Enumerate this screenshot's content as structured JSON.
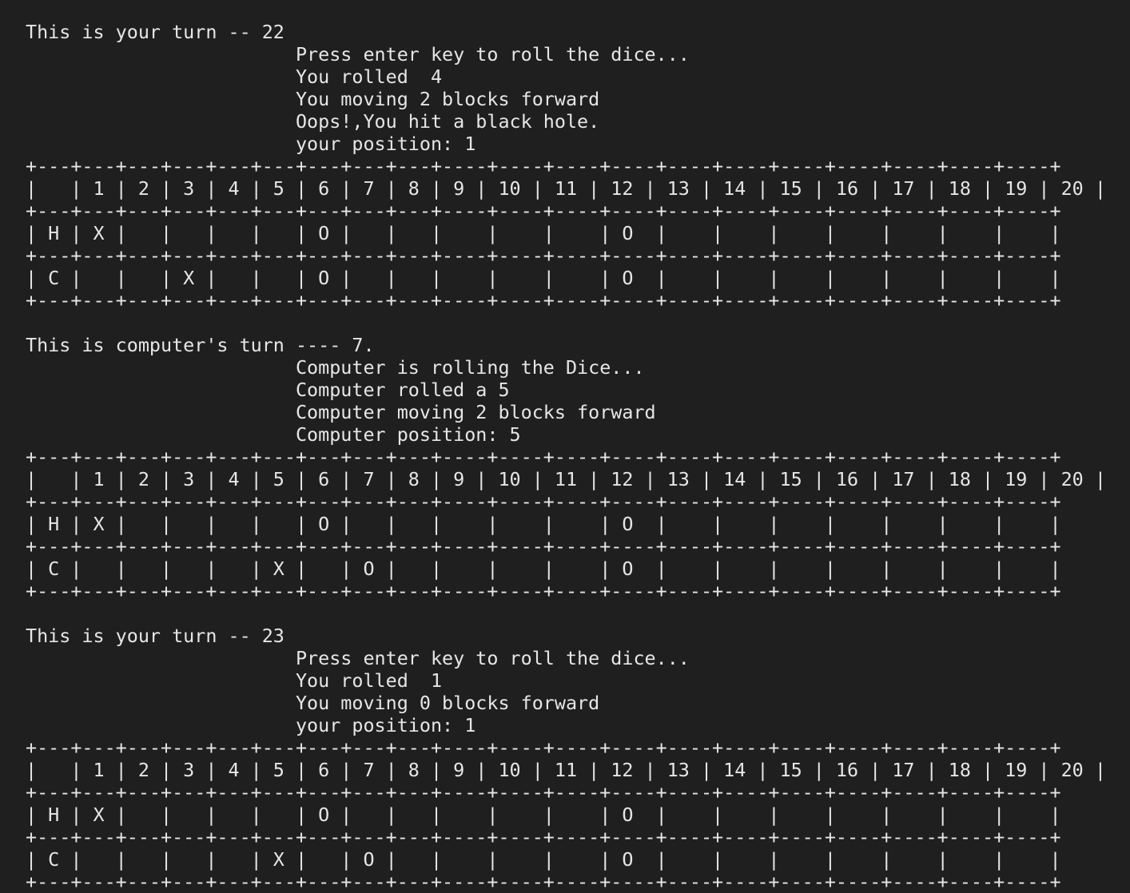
{
  "terminal": {
    "lines": [
      "This is your turn -- 22",
      "                        Press enter key to roll the dice...",
      "                        You rolled  4",
      "                        You moving 2 blocks forward",
      "                        Oops!,You hit a black hole.",
      "                        your position: 1",
      "+---+---+---+---+---+---+---+---+---+----+----+----+----+----+----+----+----+----+----+----+",
      "|   | 1 | 2 | 3 | 4 | 5 | 6 | 7 | 8 | 9 | 10 | 11 | 12 | 13 | 14 | 15 | 16 | 17 | 18 | 19 | 20 |",
      "+---+---+---+---+---+---+---+---+---+----+----+----+----+----+----+----+----+----+----+----+",
      "| H | X |   |   |   |   | O |   |   |    |    |    | O  |    |    |    |    |    |    |    |",
      "+---+---+---+---+---+---+---+---+---+----+----+----+----+----+----+----+----+----+----+----+",
      "| C |   |   | X |   |   | O |   |   |    |    |    | O  |    |    |    |    |    |    |    |",
      "+---+---+---+---+---+---+---+---+---+----+----+----+----+----+----+----+----+----+----+----+",
      "",
      "This is computer's turn ---- 7.",
      "                        Computer is rolling the Dice...",
      "                        Computer rolled a 5",
      "                        Computer moving 2 blocks forward",
      "                        Computer position: 5",
      "+---+---+---+---+---+---+---+---+---+----+----+----+----+----+----+----+----+----+----+----+",
      "|   | 1 | 2 | 3 | 4 | 5 | 6 | 7 | 8 | 9 | 10 | 11 | 12 | 13 | 14 | 15 | 16 | 17 | 18 | 19 | 20 |",
      "+---+---+---+---+---+---+---+---+---+----+----+----+----+----+----+----+----+----+----+----+",
      "| H | X |   |   |   |   | O |   |   |    |    |    | O  |    |    |    |    |    |    |    |",
      "+---+---+---+---+---+---+---+---+---+----+----+----+----+----+----+----+----+----+----+----+",
      "| C |   |   |   |   | X |   | O |   |    |    |    | O  |    |    |    |    |    |    |    |",
      "+---+---+---+---+---+---+---+---+---+----+----+----+----+----+----+----+----+----+----+----+",
      "",
      "This is your turn -- 23",
      "                        Press enter key to roll the dice...",
      "                        You rolled  1",
      "                        You moving 0 blocks forward",
      "                        your position: 1",
      "+---+---+---+---+---+---+---+---+---+----+----+----+----+----+----+----+----+----+----+----+",
      "|   | 1 | 2 | 3 | 4 | 5 | 6 | 7 | 8 | 9 | 10 | 11 | 12 | 13 | 14 | 15 | 16 | 17 | 18 | 19 | 20 |",
      "+---+---+---+---+---+---+---+---+---+----+----+----+----+----+----+----+----+----+----+----+",
      "| H | X |   |   |   |   | O |   |   |    |    |    | O  |    |    |    |    |    |    |    |",
      "+---+---+---+---+---+---+---+---+---+----+----+----+----+----+----+----+----+----+----+----+",
      "| C |   |   |   |   | X |   | O |   |    |    |    | O  |    |    |    |    |    |    |    |",
      "+---+---+---+---+---+---+---+---+---+----+----+----+----+----+----+----+----+----+----+----+"
    ]
  }
}
